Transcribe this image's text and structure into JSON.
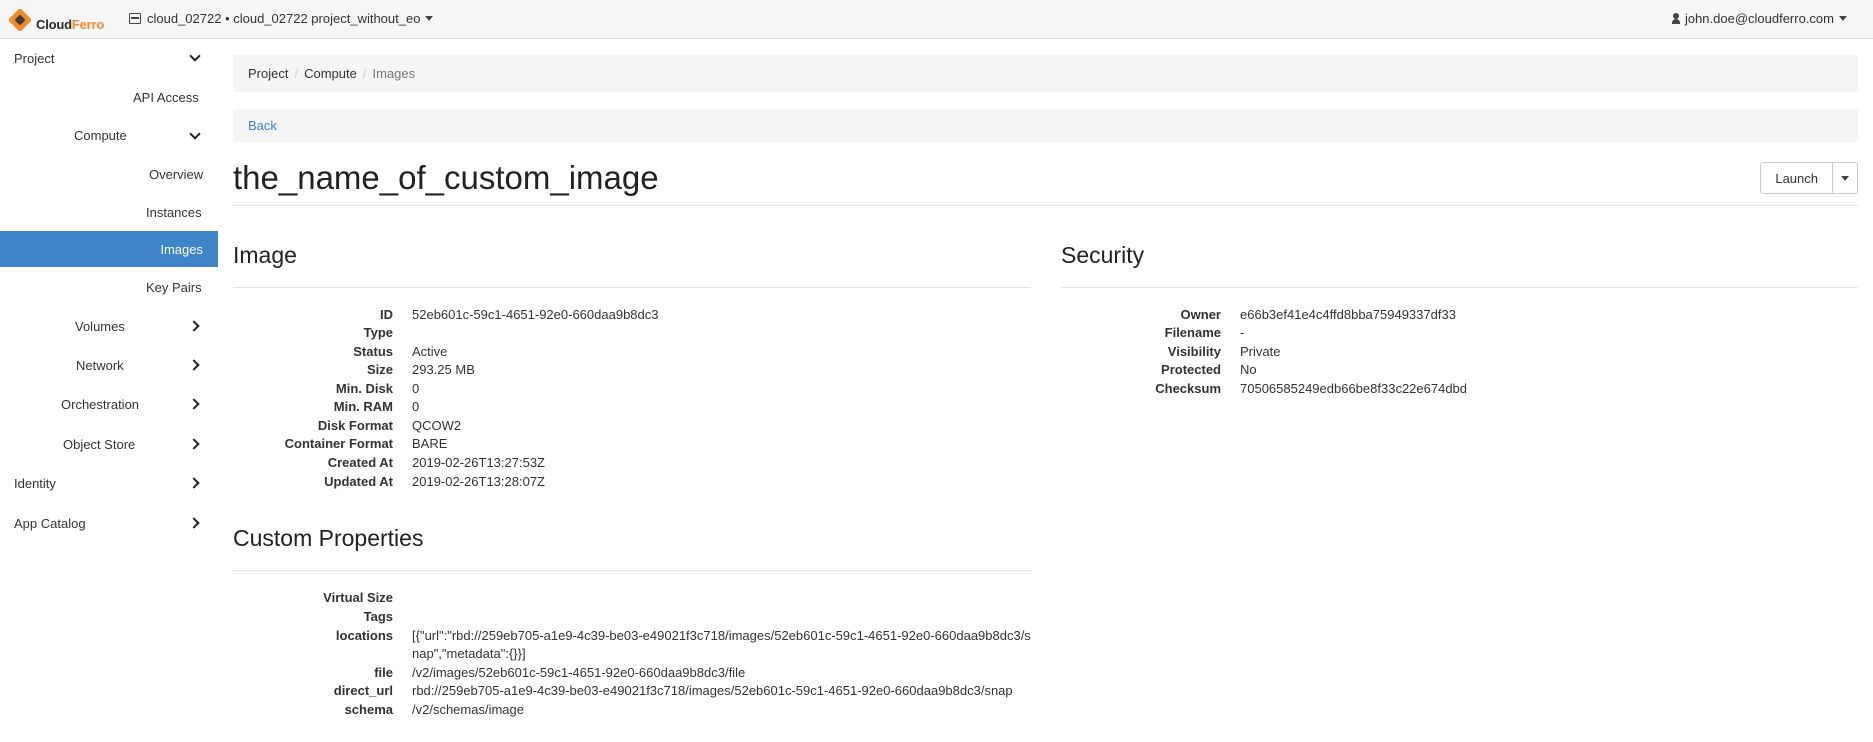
{
  "header": {
    "brand_main": "Cloud",
    "brand_accent": "Ferro",
    "project_switcher": "cloud_02722 • cloud_02722 project_without_eo",
    "user": "john.doe@cloudferro.com"
  },
  "sidebar": {
    "items": [
      {
        "label": "Project",
        "expanded": true
      },
      {
        "label": "API Access"
      },
      {
        "label": "Compute",
        "expanded": true
      },
      {
        "label": "Overview"
      },
      {
        "label": "Instances"
      },
      {
        "label": "Images",
        "active": true
      },
      {
        "label": "Key Pairs"
      },
      {
        "label": "Volumes"
      },
      {
        "label": "Network"
      },
      {
        "label": "Orchestration"
      },
      {
        "label": "Object Store"
      },
      {
        "label": "Identity"
      },
      {
        "label": "App Catalog"
      }
    ],
    "active_color": "#3d85c6"
  },
  "breadcrumb": [
    "Project",
    "Compute",
    "Images"
  ],
  "back_label": "Back",
  "page_title": "the_name_of_custom_image",
  "launch": {
    "label": "Launch"
  },
  "image_section": {
    "title": "Image",
    "rows": [
      {
        "key": "ID",
        "value": "52eb601c-59c1-4651-92e0-660daa9b8dc3"
      },
      {
        "key": "Type",
        "value": ""
      },
      {
        "key": "Status",
        "value": "Active"
      },
      {
        "key": "Size",
        "value": "293.25 MB"
      },
      {
        "key": "Min. Disk",
        "value": "0"
      },
      {
        "key": "Min. RAM",
        "value": "0"
      },
      {
        "key": "Disk Format",
        "value": "QCOW2"
      },
      {
        "key": "Container Format",
        "value": "BARE"
      },
      {
        "key": "Created At",
        "value": "2019-02-26T13:27:53Z"
      },
      {
        "key": "Updated At",
        "value": "2019-02-26T13:28:07Z"
      }
    ]
  },
  "security_section": {
    "title": "Security",
    "rows": [
      {
        "key": "Owner",
        "value": "e66b3ef41e4c4ffd8bba75949337df33"
      },
      {
        "key": "Filename",
        "value": "-"
      },
      {
        "key": "Visibility",
        "value": "Private"
      },
      {
        "key": "Protected",
        "value": "No"
      },
      {
        "key": "Checksum",
        "value": "70506585249edb66be8f33c22e674dbd"
      }
    ]
  },
  "custom_section": {
    "title": "Custom Properties",
    "rows": [
      {
        "key": "Virtual Size",
        "value": ""
      },
      {
        "key": "Tags",
        "value": ""
      },
      {
        "key": "locations",
        "value": "[{\"url\":\"rbd://259eb705-a1e9-4c39-be03-e49021f3c718/images/52eb601c-59c1-4651-92e0-660daa9b8dc3/snap\",\"metadata\":{}}]"
      },
      {
        "key": "file",
        "value": "/v2/images/52eb601c-59c1-4651-92e0-660daa9b8dc3/file"
      },
      {
        "key": "direct_url",
        "value": "rbd://259eb705-a1e9-4c39-be03-e49021f3c718/images/52eb601c-59c1-4651-92e0-660daa9b8dc3/snap"
      },
      {
        "key": "schema",
        "value": "/v2/schemas/image"
      }
    ]
  }
}
